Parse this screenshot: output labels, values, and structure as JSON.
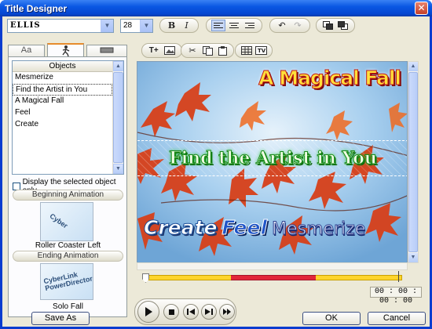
{
  "window": {
    "title": "Title Designer",
    "close_glyph": "✕"
  },
  "toolbar": {
    "font_name": "ELLIS",
    "font_size": "28",
    "bold_label": "B",
    "italic_label": "I",
    "align_left_icon": "align-left-icon",
    "align_center_icon": "align-center-icon",
    "align_right_icon": "align-right-icon",
    "undo_icon": "undo-icon",
    "redo_icon": "redo-icon",
    "bring_front_icon": "bring-to-front-icon",
    "send_back_icon": "send-to-back-icon"
  },
  "tabs": [
    {
      "label": "Aa",
      "name": "tab-text-style"
    },
    {
      "label": "",
      "name": "tab-animation"
    },
    {
      "label": "",
      "name": "tab-background"
    }
  ],
  "objects": {
    "header": "Objects",
    "items": [
      "Mesmerize",
      "Find the Artist in You",
      "A Magical Fall",
      "Feel",
      "Create"
    ],
    "selected_index": 1
  },
  "display_selected_only": {
    "label": "Display the selected object only",
    "checked": false
  },
  "beginning_animation": {
    "header": "Beginning Animation",
    "name": "Roller Coaster Left",
    "thumb_text": "Cyber"
  },
  "ending_animation": {
    "header": "Ending Animation",
    "name": "Solo Fall",
    "thumb_text": "CyberLink PowerDirector"
  },
  "preview_toolbar": {
    "insert_text_icon": "insert-text-icon",
    "insert_image_icon": "insert-image-icon",
    "cut_icon": "cut-icon",
    "copy_icon": "copy-icon",
    "paste_icon": "paste-icon",
    "grid_icon": "grid-icon",
    "tv_safe_icon": "tv-safe-zone-icon"
  },
  "preview": {
    "title_top": "A Magical Fall",
    "title_middle": "Find the Artist in You",
    "word_create": "Create",
    "word_feel": "Feel",
    "word_mesmerize": "Mesmerize"
  },
  "timeline": {
    "timecode": "00 : 00 : 00 : 00",
    "colors": {
      "track": "#ffd52a",
      "highlight": "#e2263a"
    }
  },
  "transport": {
    "play_icon": "play-icon",
    "stop_icon": "stop-icon",
    "prev_frame_icon": "previous-frame-icon",
    "next_frame_icon": "next-frame-icon",
    "fast_forward_icon": "fast-forward-icon"
  },
  "buttons": {
    "save_as": "Save As",
    "ok": "OK",
    "cancel": "Cancel"
  }
}
